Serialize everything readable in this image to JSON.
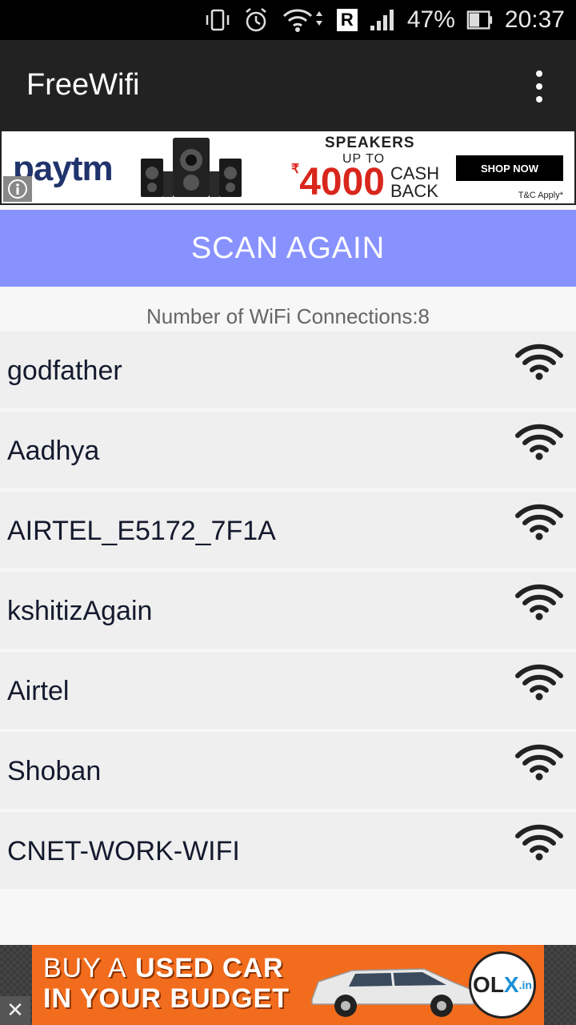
{
  "status_bar": {
    "battery_percent": "47%",
    "time": "20:37",
    "roaming_badge": "R",
    "icons": [
      "vibrate-icon",
      "alarm-icon",
      "wifi-signal-icon",
      "roaming-icon",
      "cell-signal-icon",
      "battery-icon"
    ]
  },
  "app_bar": {
    "title": "FreeWifi",
    "menu_icon": "overflow-menu-icon"
  },
  "ad_top": {
    "brand": "paytm",
    "headline": "SPEAKERS",
    "subhead": "UP TO",
    "currency": "₹",
    "amount": "4000",
    "cashback": "CASH BACK",
    "cta": "SHOP NOW",
    "terms": "T&C Apply*",
    "info_icon": "info-icon"
  },
  "scan_button": {
    "label": "SCAN AGAIN"
  },
  "count_label": "Number of WiFi Connections:8",
  "networks": [
    {
      "name": "godfather"
    },
    {
      "name": "Aadhya"
    },
    {
      "name": "AIRTEL_E5172_7F1A"
    },
    {
      "name": "kshitizAgain"
    },
    {
      "name": "Airtel"
    },
    {
      "name": "Shoban"
    },
    {
      "name": "CNET-WORK-WIFI"
    }
  ],
  "ad_bottom": {
    "line1_a": "BUY A",
    "line1_b": "USED CAR",
    "line2": "IN YOUR BUDGET",
    "logo_o": "O",
    "logo_l": "L",
    "logo_x": "X",
    "logo_in": ".in",
    "close_label": "✕"
  }
}
